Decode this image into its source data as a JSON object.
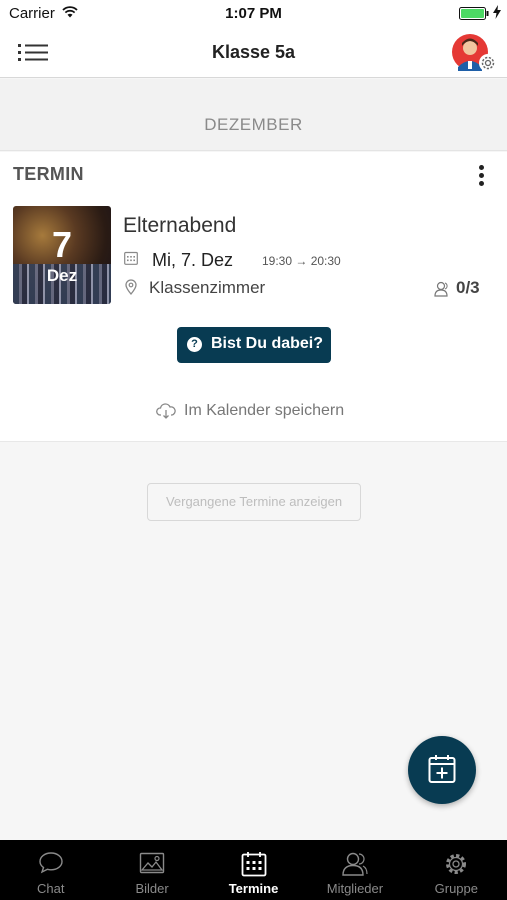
{
  "status_bar": {
    "carrier": "Carrier",
    "time": "1:07 PM",
    "battery_color": "#4cd964"
  },
  "header": {
    "title": "Klasse 5a",
    "menu_icon": "list-menu-icon",
    "avatar_icon": "user-avatar",
    "settings_icon": "gear-icon"
  },
  "month": {
    "label": "DEZEMBER"
  },
  "event": {
    "type_label": "TERMIN",
    "thumb_day": "7",
    "thumb_month": "Dez",
    "title": "Elternabend",
    "date": "Mi, 7. Dez",
    "time": "19:30 → 20:30",
    "location": "Klassenzimmer",
    "participants": "0/3",
    "rsvp_label": "Bist Du dabei?",
    "save_calendar_label": "Im Kalender speichern"
  },
  "past_events_label": "Vergangene Termine anzeigen",
  "fab_icon": "add-event-icon",
  "colors": {
    "accent": "#083b52",
    "tab_bar_bg": "#000000"
  },
  "tabs": [
    {
      "label": "Chat",
      "icon": "chat-bubble-icon",
      "active": false
    },
    {
      "label": "Bilder",
      "icon": "image-icon",
      "active": false
    },
    {
      "label": "Termine",
      "icon": "calendar-icon",
      "active": true
    },
    {
      "label": "Mitglieder",
      "icon": "members-icon",
      "active": false
    },
    {
      "label": "Gruppe",
      "icon": "gear-icon",
      "active": false
    }
  ]
}
